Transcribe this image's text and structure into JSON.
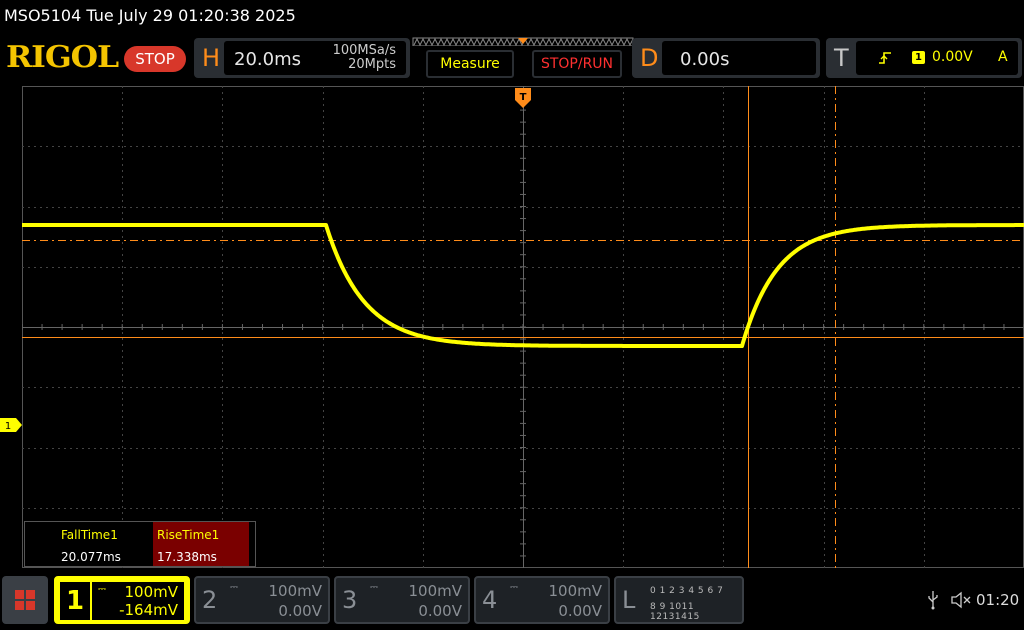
{
  "title": "MSO5104  Tue July 29 01:20:38 2025",
  "brand": "RIGOL",
  "run_state": "STOP",
  "horizontal": {
    "label": "H",
    "timebase": "20.0ms",
    "sample_rate": "100MSa/s",
    "mem_depth": "20Mpts"
  },
  "buttons": {
    "measure": "Measure",
    "stop_run": "STOP/RUN"
  },
  "delay": {
    "label": "D",
    "value": "0.00s"
  },
  "trigger": {
    "label": "T",
    "channel": "1",
    "level": "0.00V",
    "mode": "A",
    "slope_icon": "rising-edge-icon"
  },
  "channel_marker": "1",
  "measurements": [
    {
      "name": "FallTime1",
      "value": "20.077ms"
    },
    {
      "name": "RiseTime1",
      "value": "17.338ms"
    }
  ],
  "channels": [
    {
      "num": "1",
      "scale": "100mV",
      "offset": "-164mV",
      "active": true,
      "color": "#ffff00"
    },
    {
      "num": "2",
      "scale": "100mV",
      "offset": "0.00V",
      "active": false
    },
    {
      "num": "3",
      "scale": "100mV",
      "offset": "0.00V",
      "active": false
    },
    {
      "num": "4",
      "scale": "100mV",
      "offset": "0.00V",
      "active": false
    }
  ],
  "logic": {
    "label": "L",
    "row1": "0 1 2 3   4 5 6 7",
    "row2": "8 9 1011 12131415"
  },
  "system": {
    "clock": "01:20",
    "usb_icon": "usb-icon",
    "mute_icon": "speaker-muted-icon"
  },
  "colors": {
    "ch1": "#ffff00",
    "accent": "#ff8c1a",
    "stop": "#d8372a",
    "rise_bg": "#7a0000"
  }
}
